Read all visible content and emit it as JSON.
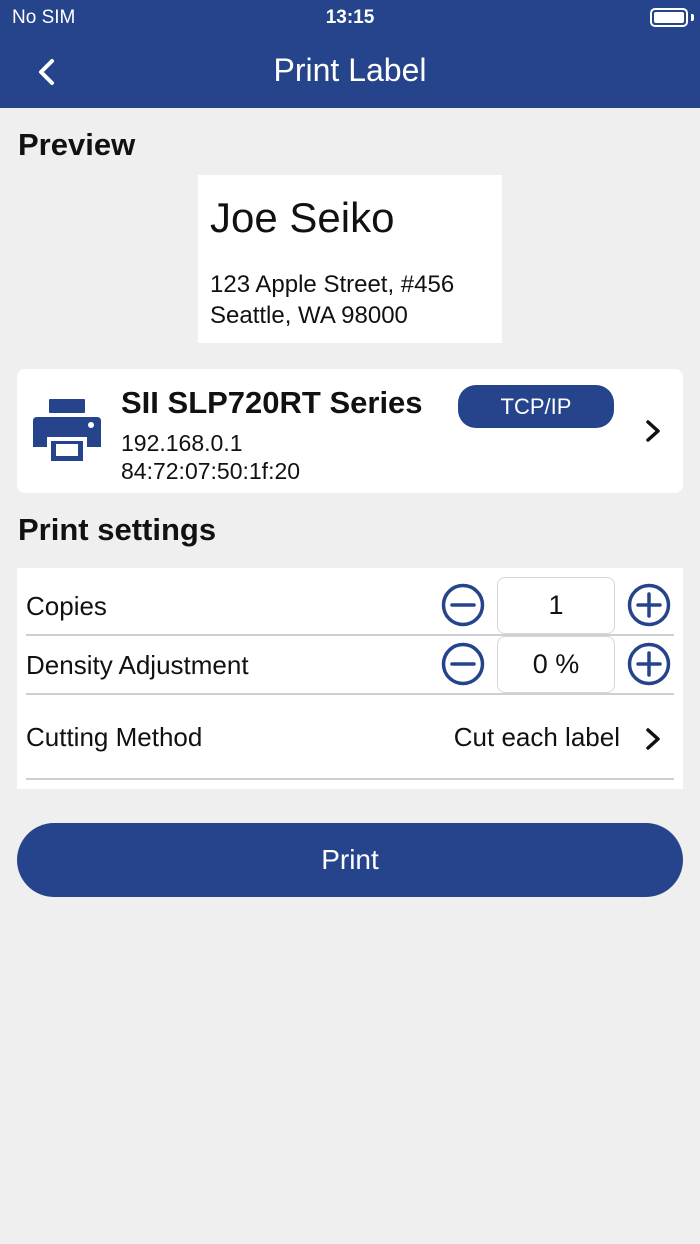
{
  "status_bar": {
    "carrier": "No SIM",
    "time": "13:15"
  },
  "nav": {
    "title": "Print Label"
  },
  "preview": {
    "heading": "Preview",
    "label": {
      "name": "Joe Seiko",
      "address_line1": "123 Apple Street, #456",
      "address_line2": "Seattle, WA 98000"
    }
  },
  "printer": {
    "name": "SII SLP720RT Series",
    "connection": "TCP/IP",
    "ip": "192.168.0.1",
    "mac": "84:72:07:50:1f:20"
  },
  "settings": {
    "heading": "Print settings",
    "copies": {
      "label": "Copies",
      "value": "1"
    },
    "density": {
      "label": "Density Adjustment",
      "value": "0 %"
    },
    "cutting": {
      "label": "Cutting Method",
      "value": "Cut each label"
    }
  },
  "actions": {
    "print_label": "Print"
  },
  "colors": {
    "brand": "#26448b",
    "background": "#efeff0"
  }
}
